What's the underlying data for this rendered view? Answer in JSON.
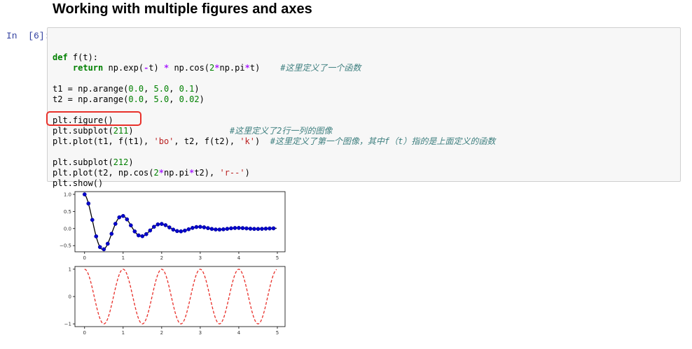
{
  "heading": "Working with multiple figures and axes",
  "cell": {
    "prompt": "In  [6]:",
    "lines": [
      [],
      [
        {
          "t": "def",
          "c": "kw"
        },
        {
          "t": " f(t):",
          "c": ""
        }
      ],
      [
        {
          "t": "    ",
          "c": ""
        },
        {
          "t": "return",
          "c": "kw"
        },
        {
          "t": " np.exp(",
          "c": ""
        },
        {
          "t": "-",
          "c": "op"
        },
        {
          "t": "t) ",
          "c": ""
        },
        {
          "t": "*",
          "c": "op"
        },
        {
          "t": " np.cos(",
          "c": ""
        },
        {
          "t": "2",
          "c": "num"
        },
        {
          "t": "*",
          "c": "op"
        },
        {
          "t": "np.pi",
          "c": ""
        },
        {
          "t": "*",
          "c": "op"
        },
        {
          "t": "t)    ",
          "c": ""
        },
        {
          "t": "#这里定义了一个函数",
          "c": "cm"
        }
      ],
      [],
      [
        {
          "t": "t1 = np.arange(",
          "c": ""
        },
        {
          "t": "0.0",
          "c": "num"
        },
        {
          "t": ", ",
          "c": ""
        },
        {
          "t": "5.0",
          "c": "num"
        },
        {
          "t": ", ",
          "c": ""
        },
        {
          "t": "0.1",
          "c": "num"
        },
        {
          "t": ")",
          "c": ""
        }
      ],
      [
        {
          "t": "t2 = np.arange(",
          "c": ""
        },
        {
          "t": "0.0",
          "c": "num"
        },
        {
          "t": ", ",
          "c": ""
        },
        {
          "t": "5.0",
          "c": "num"
        },
        {
          "t": ", ",
          "c": ""
        },
        {
          "t": "0.02",
          "c": "num"
        },
        {
          "t": ")",
          "c": ""
        }
      ],
      [],
      [
        {
          "t": "plt.figure()",
          "c": ""
        }
      ],
      [
        {
          "t": "plt.subplot(",
          "c": ""
        },
        {
          "t": "211",
          "c": "num"
        },
        {
          "t": ")                   ",
          "c": ""
        },
        {
          "t": "#这里定义了2行一列的图像",
          "c": "cm"
        }
      ],
      [
        {
          "t": "plt.plot(t1, f(t1), ",
          "c": ""
        },
        {
          "t": "'bo'",
          "c": "str"
        },
        {
          "t": ", t2, f(t2), ",
          "c": ""
        },
        {
          "t": "'k'",
          "c": "str"
        },
        {
          "t": ")  ",
          "c": ""
        },
        {
          "t": "#这里定义了第一个图像，其中f（t）指的是上面定义的函数",
          "c": "cm"
        }
      ],
      [],
      [
        {
          "t": "plt.subplot(",
          "c": ""
        },
        {
          "t": "212",
          "c": "num"
        },
        {
          "t": ")",
          "c": ""
        }
      ],
      [
        {
          "t": "plt.plot(t2, np.cos(",
          "c": ""
        },
        {
          "t": "2",
          "c": "num"
        },
        {
          "t": "*",
          "c": "op"
        },
        {
          "t": "np.pi",
          "c": ""
        },
        {
          "t": "*",
          "c": "op"
        },
        {
          "t": "t2), ",
          "c": ""
        },
        {
          "t": "'r--'",
          "c": "str"
        },
        {
          "t": ")",
          "c": ""
        }
      ],
      [
        {
          "t": "plt.show()",
          "c": ""
        }
      ]
    ]
  },
  "chart_data": [
    {
      "type": "line",
      "function": "exp(-t)*cos(2*pi*t)",
      "series": [
        {
          "name": "",
          "style": "bo",
          "color": "#0000cc",
          "x_range": [
            0.0,
            5.0
          ],
          "x_step": 0.1
        },
        {
          "name": "",
          "style": "k",
          "color": "#000000",
          "x_range": [
            0.0,
            5.0
          ],
          "x_step": 0.02
        }
      ],
      "xticks": [
        "0",
        "1",
        "2",
        "3",
        "4",
        "5"
      ],
      "yticks": [
        "1.0",
        "0.5",
        "0.0",
        "−0.5"
      ],
      "xlim": [
        -0.25,
        5.2
      ],
      "ylim": [
        -0.68,
        1.08
      ]
    },
    {
      "type": "line",
      "function": "cos(2*pi*t)",
      "series": [
        {
          "name": "",
          "style": "r--",
          "color": "#e8302a",
          "x_range": [
            0.0,
            5.0
          ],
          "x_step": 0.02
        }
      ],
      "xticks": [
        "0",
        "1",
        "2",
        "3",
        "4",
        "5"
      ],
      "yticks": [
        "1",
        "0",
        "−1"
      ],
      "xlim": [
        -0.25,
        5.2
      ],
      "ylim": [
        -1.1,
        1.1
      ]
    }
  ]
}
